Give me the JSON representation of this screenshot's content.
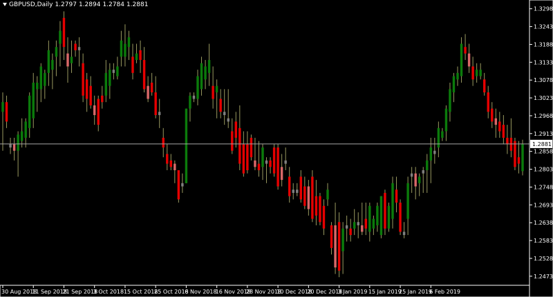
{
  "header": {
    "symbol": "GBPUSD,Daily",
    "open": "1.2797",
    "high": "1.2894",
    "low": "1.2784",
    "close": "1.2881"
  },
  "colors": {
    "background": "#000000",
    "axis": "#ffffff",
    "bull": "#0b7b0b",
    "bear": "#e60000",
    "bear_light": "#d96868",
    "doji": "#7f7f7f",
    "blue": "#4060d0",
    "wick": "#9a9a60",
    "price_line": "#a8a8a8"
  },
  "chart_data": {
    "type": "candlestick",
    "symbol": "GBPUSD",
    "timeframe": "Daily",
    "ylim": [
      1.2445,
      1.3325
    ],
    "y_ticks": [
      "1.3298",
      "1.3243",
      "1.3188",
      "1.3133",
      "1.3078",
      "1.3023",
      "1.2968",
      "1.2913",
      "1.2858",
      "1.2803",
      "1.2748",
      "1.2693",
      "1.2638",
      "1.2583",
      "1.2528",
      "1.2473"
    ],
    "x_ticks": [
      "30 Aug 2018",
      "11 Sep 2018",
      "21 Sep 2018",
      "3 Oct 2018",
      "15 Oct 2018",
      "25 Oct 2018",
      "6 Nov 2018",
      "16 Nov 2018",
      "28 Nov 2018",
      "10 Dec 2018",
      "20 Dec 2018",
      "3 Jan 2019",
      "15 Jan 2019",
      "25 Jan 2019",
      "6 Feb 2019"
    ],
    "x_tick_index": [
      0,
      8,
      16,
      24,
      32,
      40,
      48,
      56,
      64,
      72,
      80,
      88,
      96,
      104,
      112
    ],
    "current_price": "1.2881",
    "candles": [
      [
        1.298,
        1.304,
        1.286,
        1.301
      ],
      [
        1.301,
        1.303,
        1.293,
        1.295
      ],
      [
        1.287,
        1.29,
        1.285,
        1.288
      ],
      [
        1.288,
        1.29,
        1.283,
        1.286
      ],
      [
        1.286,
        1.292,
        1.278,
        1.291
      ],
      [
        1.289,
        1.296,
        1.287,
        1.292
      ],
      [
        1.29,
        1.296,
        1.287,
        1.295
      ],
      [
        1.293,
        1.304,
        1.29,
        1.303
      ],
      [
        1.296,
        1.31,
        1.293,
        1.307
      ],
      [
        1.305,
        1.309,
        1.298,
        1.307
      ],
      [
        1.305,
        1.313,
        1.301,
        1.312
      ],
      [
        1.306,
        1.311,
        1.302,
        1.31
      ],
      [
        1.31,
        1.32,
        1.306,
        1.317
      ],
      [
        1.311,
        1.316,
        1.305,
        1.314
      ],
      [
        1.315,
        1.32,
        1.309,
        1.318
      ],
      [
        1.319,
        1.326,
        1.312,
        1.323
      ],
      [
        1.327,
        1.329,
        1.314,
        1.318
      ],
      [
        1.316,
        1.321,
        1.307,
        1.312
      ],
      [
        1.313,
        1.32,
        1.31,
        1.315
      ],
      [
        1.319,
        1.32,
        1.315,
        1.317
      ],
      [
        1.318,
        1.321,
        1.312,
        1.317
      ],
      [
        1.313,
        1.316,
        1.301,
        1.303
      ],
      [
        1.308,
        1.31,
        1.298,
        1.302
      ],
      [
        1.306,
        1.309,
        1.299,
        1.3
      ],
      [
        1.3,
        1.303,
        1.294,
        1.297
      ],
      [
        1.302,
        1.303,
        1.292,
        1.294
      ],
      [
        1.303,
        1.306,
        1.299,
        1.301
      ],
      [
        1.303,
        1.314,
        1.301,
        1.31
      ],
      [
        1.306,
        1.313,
        1.302,
        1.311
      ],
      [
        1.31,
        1.313,
        1.308,
        1.311
      ],
      [
        1.309,
        1.315,
        1.308,
        1.312
      ],
      [
        1.315,
        1.323,
        1.312,
        1.32
      ],
      [
        1.315,
        1.325,
        1.312,
        1.319
      ],
      [
        1.318,
        1.323,
        1.314,
        1.321
      ],
      [
        1.315,
        1.319,
        1.308,
        1.31
      ],
      [
        1.314,
        1.319,
        1.313,
        1.316
      ],
      [
        1.317,
        1.32,
        1.31,
        1.314
      ],
      [
        1.314,
        1.318,
        1.304,
        1.305
      ],
      [
        1.306,
        1.309,
        1.301,
        1.302
      ],
      [
        1.307,
        1.31,
        1.303,
        1.304
      ],
      [
        1.304,
        1.309,
        1.296,
        1.297
      ],
      [
        1.297,
        1.302,
        1.293,
        1.298
      ],
      [
        1.29,
        1.293,
        1.284,
        1.287
      ],
      [
        1.285,
        1.288,
        1.28,
        1.282
      ],
      [
        1.283,
        1.285,
        1.28,
        1.281
      ],
      [
        1.282,
        1.283,
        1.276,
        1.28
      ],
      [
        1.28,
        1.28,
        1.27,
        1.271
      ],
      [
        1.275,
        1.279,
        1.273,
        1.276
      ],
      [
        1.276,
        1.299,
        1.276,
        1.299
      ],
      [
        1.299,
        1.304,
        1.295,
        1.303
      ],
      [
        1.303,
        1.304,
        1.301,
        1.302
      ],
      [
        1.302,
        1.311,
        1.3,
        1.309
      ],
      [
        1.305,
        1.315,
        1.303,
        1.313
      ],
      [
        1.308,
        1.314,
        1.305,
        1.312
      ],
      [
        1.31,
        1.319,
        1.306,
        1.314
      ],
      [
        1.306,
        1.312,
        1.299,
        1.302
      ],
      [
        1.304,
        1.308,
        1.296,
        1.306
      ],
      [
        1.302,
        1.305,
        1.296,
        1.298
      ],
      [
        1.298,
        1.305,
        1.294,
        1.297
      ],
      [
        1.296,
        1.305,
        1.293,
        1.295
      ],
      [
        1.292,
        1.296,
        1.285,
        1.286
      ],
      [
        1.295,
        1.298,
        1.287,
        1.29
      ],
      [
        1.293,
        1.3,
        1.28,
        1.282
      ],
      [
        1.288,
        1.292,
        1.278,
        1.279
      ],
      [
        1.288,
        1.292,
        1.279,
        1.28
      ],
      [
        1.29,
        1.291,
        1.283,
        1.284
      ],
      [
        1.283,
        1.29,
        1.28,
        1.281
      ],
      [
        1.282,
        1.289,
        1.278,
        1.28
      ],
      [
        1.281,
        1.288,
        1.277,
        1.287
      ],
      [
        1.282,
        1.284,
        1.276,
        1.283
      ],
      [
        1.283,
        1.284,
        1.279,
        1.281
      ],
      [
        1.287,
        1.288,
        1.278,
        1.279
      ],
      [
        1.287,
        1.288,
        1.274,
        1.275
      ],
      [
        1.281,
        1.285,
        1.275,
        1.277
      ],
      [
        1.283,
        1.287,
        1.28,
        1.282
      ],
      [
        1.278,
        1.281,
        1.27,
        1.272
      ],
      [
        1.274,
        1.276,
        1.271,
        1.273
      ],
      [
        1.274,
        1.276,
        1.272,
        1.273
      ],
      [
        1.278,
        1.28,
        1.27,
        1.271
      ],
      [
        1.275,
        1.278,
        1.268,
        1.269
      ],
      [
        1.275,
        1.277,
        1.266,
        1.268
      ],
      [
        1.278,
        1.28,
        1.264,
        1.265
      ],
      [
        1.272,
        1.277,
        1.263,
        1.266
      ],
      [
        1.272,
        1.273,
        1.263,
        1.264
      ],
      [
        1.269,
        1.271,
        1.26,
        1.262
      ],
      [
        1.271,
        1.276,
        1.269,
        1.274
      ],
      [
        1.263,
        1.264,
        1.254,
        1.256
      ],
      [
        1.263,
        1.27,
        1.248,
        1.25
      ],
      [
        1.264,
        1.267,
        1.247,
        1.249
      ],
      [
        1.255,
        1.264,
        1.248,
        1.262
      ],
      [
        1.262,
        1.266,
        1.258,
        1.263
      ],
      [
        1.262,
        1.265,
        1.258,
        1.26
      ],
      [
        1.262,
        1.268,
        1.26,
        1.264
      ],
      [
        1.263,
        1.267,
        1.259,
        1.264
      ],
      [
        1.263,
        1.27,
        1.26,
        1.261
      ],
      [
        1.265,
        1.27,
        1.26,
        1.262
      ],
      [
        1.261,
        1.27,
        1.258,
        1.269
      ],
      [
        1.262,
        1.266,
        1.26,
        1.265
      ],
      [
        1.263,
        1.27,
        1.261,
        1.269
      ],
      [
        1.26,
        1.272,
        1.259,
        1.272
      ],
      [
        1.273,
        1.274,
        1.26,
        1.262
      ],
      [
        1.262,
        1.27,
        1.261,
        1.269
      ],
      [
        1.265,
        1.278,
        1.262,
        1.276
      ],
      [
        1.274,
        1.278,
        1.267,
        1.27
      ],
      [
        1.27,
        1.271,
        1.26,
        1.261
      ],
      [
        1.261,
        1.264,
        1.259,
        1.26
      ],
      [
        1.265,
        1.278,
        1.26,
        1.276
      ],
      [
        1.278,
        1.281,
        1.273,
        1.279
      ],
      [
        1.279,
        1.281,
        1.271,
        1.275
      ],
      [
        1.276,
        1.279,
        1.272,
        1.278
      ],
      [
        1.279,
        1.281,
        1.273,
        1.28
      ],
      [
        1.28,
        1.285,
        1.273,
        1.283
      ],
      [
        1.283,
        1.29,
        1.276,
        1.287
      ],
      [
        1.286,
        1.29,
        1.282,
        1.285
      ],
      [
        1.287,
        1.295,
        1.284,
        1.293
      ],
      [
        1.29,
        1.293,
        1.289,
        1.292
      ],
      [
        1.292,
        1.3,
        1.289,
        1.299
      ],
      [
        1.298,
        1.307,
        1.295,
        1.305
      ],
      [
        1.304,
        1.31,
        1.301,
        1.309
      ],
      [
        1.308,
        1.312,
        1.306,
        1.31
      ],
      [
        1.309,
        1.321,
        1.307,
        1.319
      ],
      [
        1.318,
        1.322,
        1.314,
        1.316
      ],
      [
        1.316,
        1.319,
        1.31,
        1.312
      ],
      [
        1.312,
        1.315,
        1.306,
        1.308
      ],
      [
        1.309,
        1.313,
        1.307,
        1.311
      ],
      [
        1.309,
        1.313,
        1.308,
        1.311
      ],
      [
        1.308,
        1.31,
        1.303,
        1.304
      ],
      [
        1.304,
        1.306,
        1.296,
        1.298
      ],
      [
        1.299,
        1.301,
        1.293,
        1.295
      ],
      [
        1.296,
        1.299,
        1.29,
        1.294
      ],
      [
        1.295,
        1.298,
        1.29,
        1.292
      ],
      [
        1.294,
        1.297,
        1.288,
        1.29
      ],
      [
        1.29,
        1.294,
        1.285,
        1.288
      ],
      [
        1.29,
        1.296,
        1.284,
        1.286
      ],
      [
        1.289,
        1.29,
        1.28,
        1.281
      ],
      [
        1.284,
        1.289,
        1.279,
        1.282
      ],
      [
        1.2797,
        1.2894,
        1.2784,
        1.2881
      ]
    ]
  }
}
